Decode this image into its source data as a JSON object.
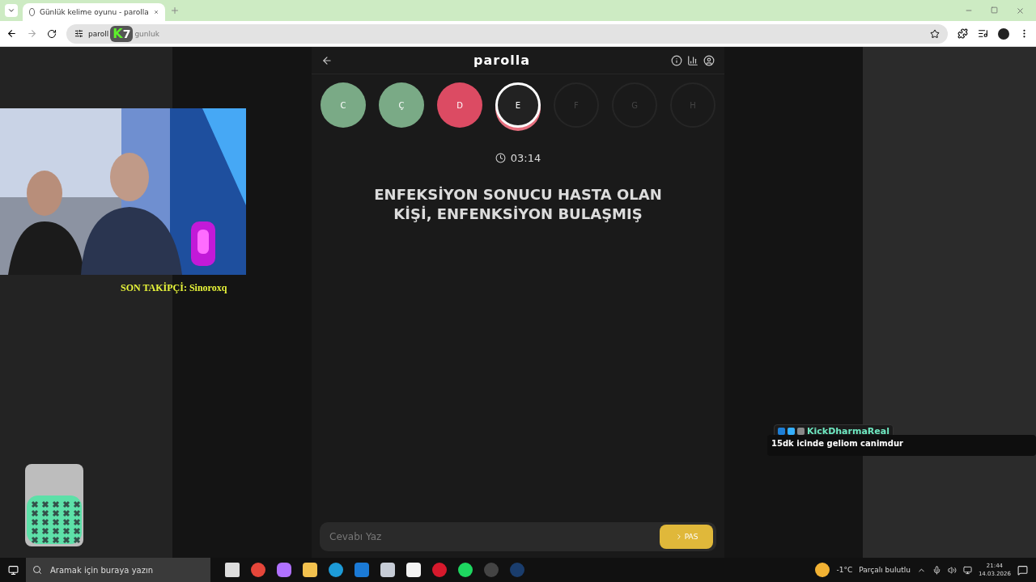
{
  "browser": {
    "tab_title": "Günlük kelime oyunu - parolla",
    "url_before": "paroll",
    "url_after": "gunluk",
    "overlay_badge": [
      "K",
      "7"
    ]
  },
  "game": {
    "title": "parolla",
    "letters": [
      {
        "letter": "C",
        "kind": "correct"
      },
      {
        "letter": "Ç",
        "kind": "correct"
      },
      {
        "letter": "D",
        "kind": "wrong"
      },
      {
        "letter": "E",
        "kind": "current"
      },
      {
        "letter": "F",
        "kind": "pending"
      },
      {
        "letter": "G",
        "kind": "pending"
      },
      {
        "letter": "H",
        "kind": "pending"
      }
    ],
    "timer": "03:14",
    "question": "ENFEKSİYON SONUCU HASTA OLAN KİŞİ, ENFENKSİYON BULAŞMIŞ",
    "answer": {
      "placeholder": "Cevabı Yaz"
    },
    "pass_button": "PAS"
  },
  "stream": {
    "follower": "SON TAKİPÇİ: Sinoroxq",
    "chat": {
      "user": "KickDharmaReal",
      "color": "#6ee7c0",
      "message": "15dk icinde geliom canimdur"
    }
  },
  "taskbar": {
    "search": {
      "placeholder": "Aramak için buraya yazın"
    },
    "temperature": "-1°C",
    "weather": "Parçalı bulutlu",
    "time": "21:44",
    "date": "14.03.2026"
  }
}
